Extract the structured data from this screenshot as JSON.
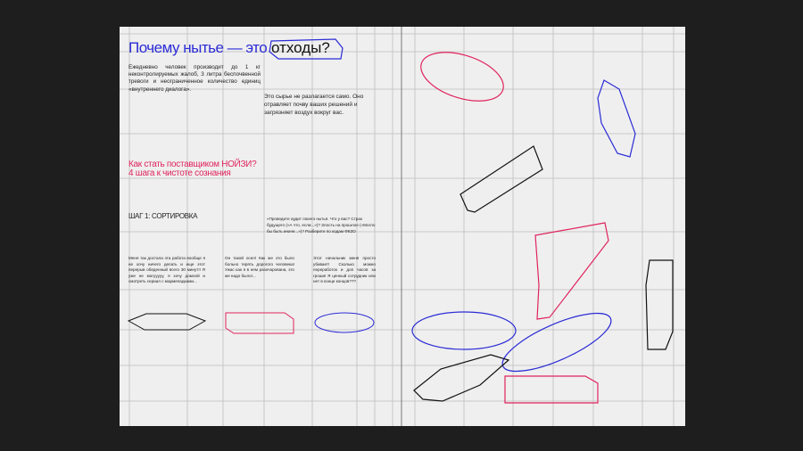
{
  "left_page": {
    "title": "Почему нытье — это",
    "title_highlight": "отходы?",
    "intro": "Ежедневно человек производит до 1 кг неконтролируемых жалоб, 3 литра беспочвенной тревоги и неограниченное количество единиц «внутреннего диалога».",
    "raw": "Это сырье не разлагается само. Оно отравляет почву ваших решений и загрязняет воздух вокруг вас.",
    "how_line1": "Как стать поставщиком НОЙЗИ?",
    "how_line2": "4 шага к чистоте сознания",
    "step": "ШАГ 1: СОРТИРОВКА",
    "quote": "«Проведите аудит своего нытья. Что у вас? Страх будущего («А что, если...»)? Злость на прошлое («Могло бы быть иначе...»)? Разберите по кодам ФКЗО",
    "cases": [
      "Меня так достала эта работа вообще я не хочу ничего делать и еще этот перерыв обеденный всего 30 минут!! Я уже не могууууу, я хочу домоой и смотреть сериал с мармеладками...",
      "Он такой осел! Как же это было больно терять дорогого человека! Ужас как я в нем разочарована, это же надо было!...",
      "Этот начальник меня просто убивает! Сколько можно переработок и доп часов за гроши! Я ценный сотрудник или нет в конце концов???"
    ]
  },
  "colors": {
    "blue": "#2b2bd6",
    "pink": "#e0245e",
    "black": "#111111",
    "paper": "#efefef",
    "background": "#1e1e1e"
  }
}
